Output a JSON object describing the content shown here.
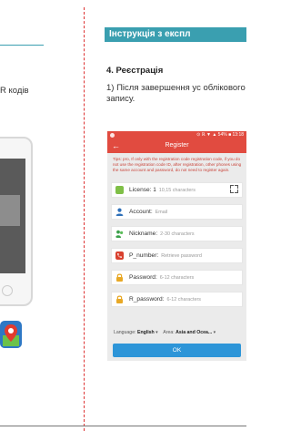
{
  "left_page": {
    "text_fragment": "R кодів"
  },
  "header": {
    "title": "Інструкція з експл"
  },
  "section": {
    "heading": "4. Реєстрація",
    "step_text": "1) Після завершення ус облікового запису."
  },
  "app_screenshot": {
    "status_text": "⊙ ℝ ▼ ▲ 54% ■ 13:18",
    "screen_title": "Register",
    "back_icon": "arrow-left-icon",
    "notice": "Tips: pro, If only with the registration code registration code, if you do not use the registration code ID, after registration, other phones using the same account and password, do not need to register again.",
    "fields": [
      {
        "label": "License:",
        "placeholder": "10,15 characters",
        "icon": "license-card-icon",
        "color": "#7fbf47",
        "current_value": "1"
      },
      {
        "label": "Account:",
        "placeholder": "Email",
        "icon": "user-icon",
        "color": "#2d6fb8"
      },
      {
        "label": "Nickname:",
        "placeholder": "2-30 characters",
        "icon": "users-icon",
        "color": "#3aa04a"
      },
      {
        "label": "P_number:",
        "placeholder": "Retrieve password",
        "icon": "phone-icon",
        "color": "#d9412f"
      },
      {
        "label": "Password:",
        "placeholder": "6-12 characters",
        "icon": "lock-icon",
        "color": "#e8a825"
      },
      {
        "label": "R_password:",
        "placeholder": "6-12 characters",
        "icon": "lock-icon",
        "color": "#e8a825"
      }
    ],
    "language_label": "Language:",
    "language_value": "English",
    "area_label": "Area:",
    "area_value": "Asia and Ocea...",
    "ok_label": "OK"
  },
  "colors": {
    "accent": "#3a9fb0",
    "app_bar": "#e14b40",
    "ok_button": "#2d95d8",
    "gutter_line": "#dd3333"
  }
}
